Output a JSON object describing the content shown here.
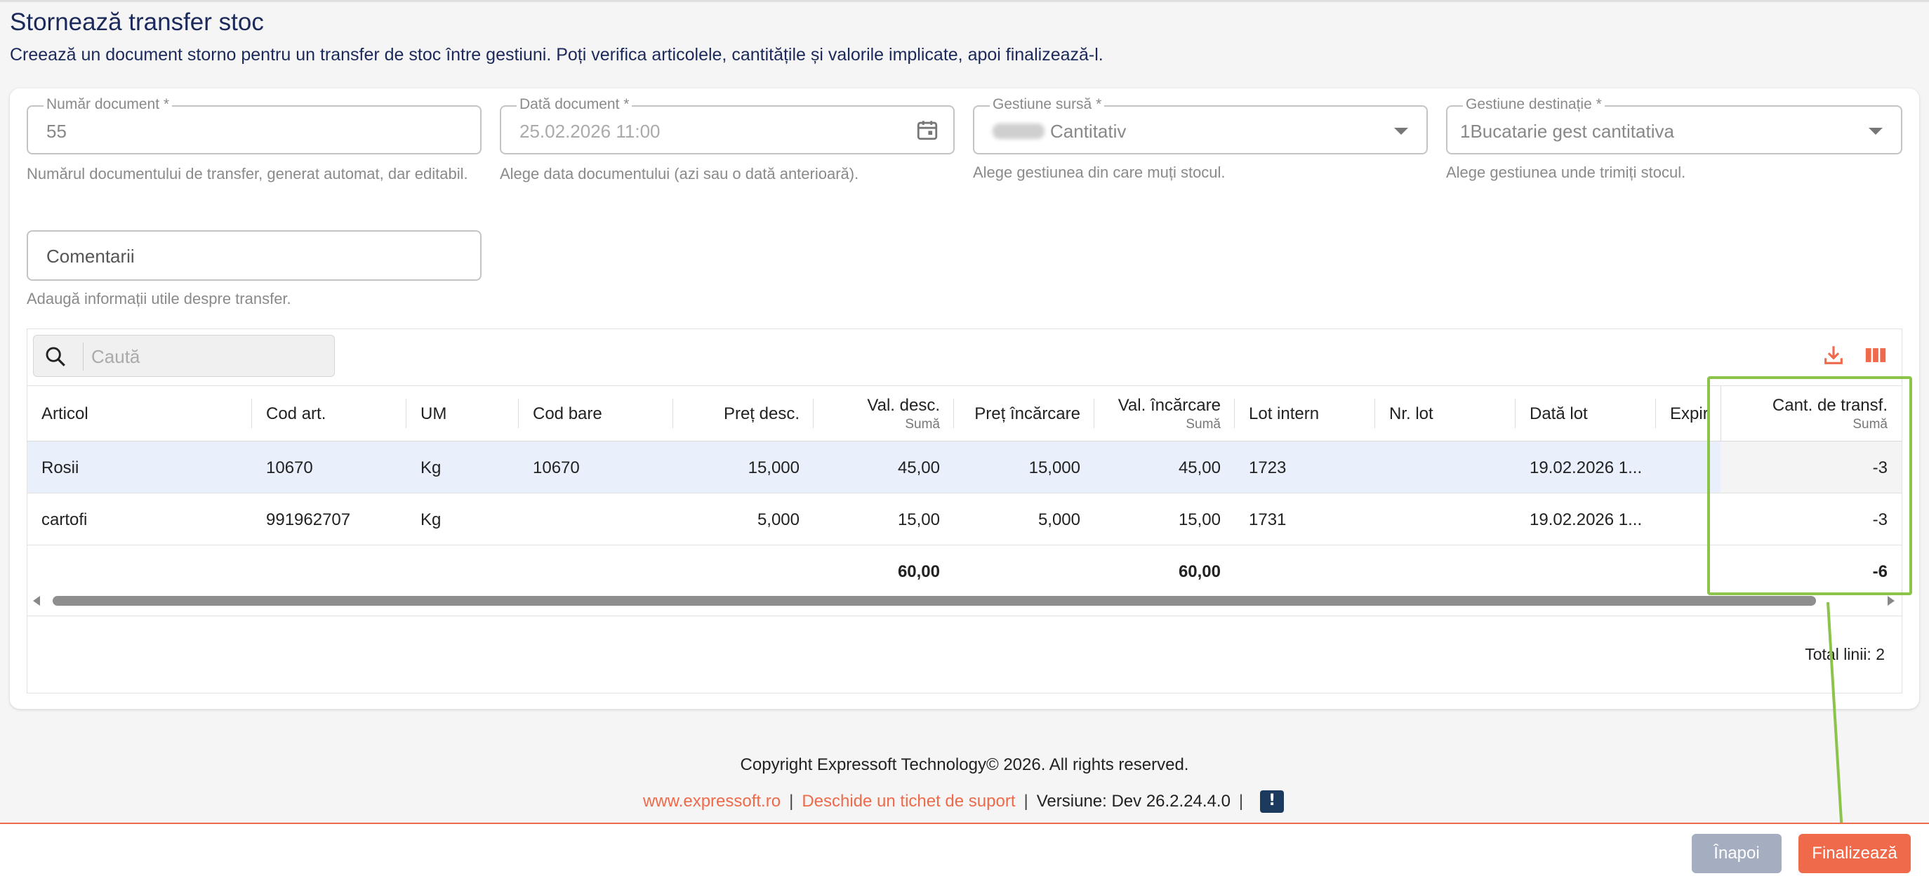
{
  "page": {
    "title": "Stornează transfer stoc",
    "subtitle": "Creează un document storno pentru un transfer de stoc între gestiuni. Poți verifica articolele, cantitățile și valorile implicate, apoi finalizează-l."
  },
  "form": {
    "doc_number": {
      "label": "Număr document *",
      "value": "55",
      "helper": "Numărul documentului de transfer, generat automat, dar editabil."
    },
    "doc_date": {
      "label": "Dată document *",
      "value": "25.02.2026 11:00",
      "helper": "Alege data documentului (azi sau o dată anterioară)."
    },
    "source": {
      "label": "Gestiune sursă *",
      "value": "Cantitativ",
      "helper": "Alege gestiunea din care muți stocul."
    },
    "dest": {
      "label": "Gestiune destinație *",
      "value": "1Bucatarie gest cantitativa",
      "helper": "Alege gestiunea unde trimiți stocul."
    },
    "comments": {
      "placeholder": "Comentarii",
      "helper": "Adaugă informații utile despre transfer."
    }
  },
  "grid": {
    "search_placeholder": "Caută",
    "columns": [
      {
        "label": "Articol",
        "sub": ""
      },
      {
        "label": "Cod art.",
        "sub": ""
      },
      {
        "label": "UM",
        "sub": ""
      },
      {
        "label": "Cod bare",
        "sub": ""
      },
      {
        "label": "Preț desc.",
        "sub": ""
      },
      {
        "label": "Val. desc.",
        "sub": "Sumă"
      },
      {
        "label": "Preț încărcare",
        "sub": ""
      },
      {
        "label": "Val. încărcare",
        "sub": "Sumă"
      },
      {
        "label": "Lot intern",
        "sub": ""
      },
      {
        "label": "Nr. lot",
        "sub": ""
      },
      {
        "label": "Dată lot",
        "sub": ""
      },
      {
        "label": "Expir",
        "sub": ""
      },
      {
        "label": "Cant. de transf.",
        "sub": "Sumă"
      }
    ],
    "rows": [
      {
        "articol": "Rosii",
        "cod": "10670",
        "um": "Kg",
        "cod_bare": "10670",
        "pret_desc": "15,000",
        "val_desc": "45,00",
        "pret_inc": "15,000",
        "val_inc": "45,00",
        "lot_intern": "1723",
        "nr_lot": "",
        "data_lot": "19.02.2026 1...",
        "cant": "-3"
      },
      {
        "articol": "cartofi",
        "cod": "991962707",
        "um": "Kg",
        "cod_bare": "",
        "pret_desc": "5,000",
        "val_desc": "15,00",
        "pret_inc": "5,000",
        "val_inc": "15,00",
        "lot_intern": "1731",
        "nr_lot": "",
        "data_lot": "19.02.2026 1...",
        "cant": "-3"
      }
    ],
    "totals": {
      "val_desc": "60,00",
      "val_inc": "60,00",
      "cant": "-6"
    },
    "total_lines": "Total linii: 2"
  },
  "footer": {
    "copyright": "Copyright Expressoft Technology© 2026. All rights reserved.",
    "site": "www.expressoft.ro",
    "ticket": "Deschide un tichet de suport",
    "version": "Versiune: Dev 26.2.24.4.0"
  },
  "actions": {
    "back": "Înapoi",
    "finish": "Finalizează"
  },
  "colors": {
    "accent": "#ee6a4b",
    "title": "#1b2a5a",
    "highlight": "#8cc34a",
    "back_button": "#a4aec0"
  }
}
